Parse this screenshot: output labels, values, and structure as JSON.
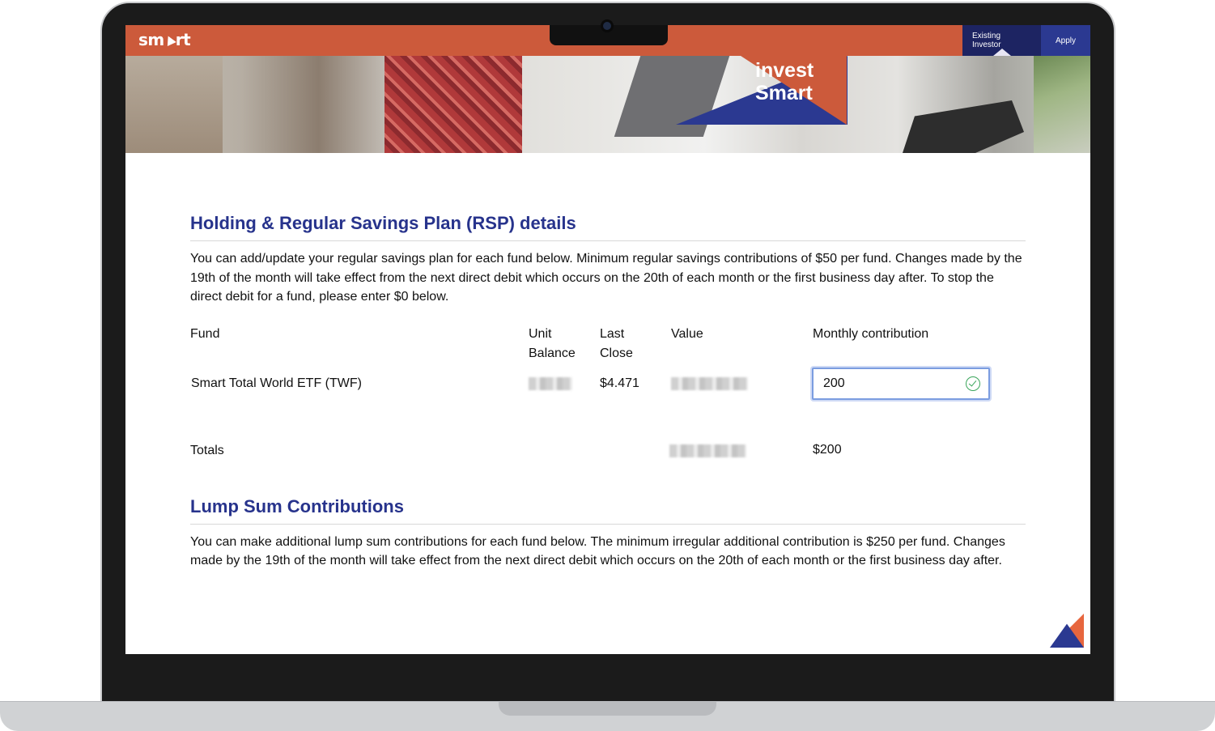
{
  "nav": {
    "logo": "sm",
    "logo_suffix": "rt",
    "existing_investor": "Existing Investor",
    "apply": "Apply"
  },
  "hero": {
    "line1": "invest",
    "line2": "Smart"
  },
  "rsp": {
    "title": "Holding & Regular Savings Plan (RSP) details",
    "description": "You can add/update your regular savings plan for each fund below. Minimum regular savings contributions of $50 per fund. Changes made by the 19th of the month will take effect from the next direct debit which occurs on the 20th of each month or the first business day after. To stop the direct debit for a fund, please enter $0 below.",
    "headers": {
      "fund": "Fund",
      "unit_balance_1": "Unit",
      "unit_balance_2": "Balance",
      "last_close_1": "Last",
      "last_close_2": "Close",
      "value": "Value",
      "monthly_contribution": "Monthly contribution"
    },
    "row": {
      "fund": "Smart Total World ETF (TWF)",
      "last_close": "$4.471",
      "monthly_contribution": "200"
    },
    "totals": {
      "label": "Totals",
      "monthly_contribution": "$200"
    }
  },
  "lump_sum": {
    "title": "Lump Sum Contributions",
    "description": "You can make additional lump sum contributions for each fund below. The minimum irregular additional contribution is $250 per fund. Changes made by the 19th of the month will take effect from the next direct debit which occurs on the 20th of each month or the first business day after."
  },
  "colors": {
    "brand_orange": "#cc5a3b",
    "brand_navy": "#1d2462",
    "brand_blue": "#2b3991",
    "heading_blue": "#27338c",
    "valid_green": "#3aa55b"
  },
  "icons": {
    "valid": "check-circle-icon",
    "corner": "brand-corner-icon"
  }
}
